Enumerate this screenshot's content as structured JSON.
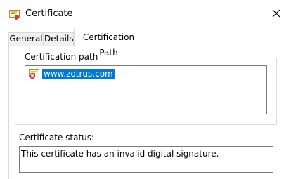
{
  "window": {
    "title": "Certificate",
    "icon": "certificate-icon",
    "close_icon": "close-icon"
  },
  "tabs": [
    {
      "label": "General",
      "active": false
    },
    {
      "label": "Details",
      "active": false
    },
    {
      "label": "Certification Path",
      "active": true
    }
  ],
  "certification_path": {
    "group_label": "Certification path",
    "items": [
      {
        "label": "www.zotrus.com",
        "selected": true,
        "icon": "certificate-error-icon"
      }
    ]
  },
  "status": {
    "label": "Certificate status:",
    "text": "This certificate has an invalid digital signature."
  },
  "colors": {
    "selection": "#0078d7",
    "border": "#7a7a7a",
    "tab_border": "#d9d9d9"
  }
}
